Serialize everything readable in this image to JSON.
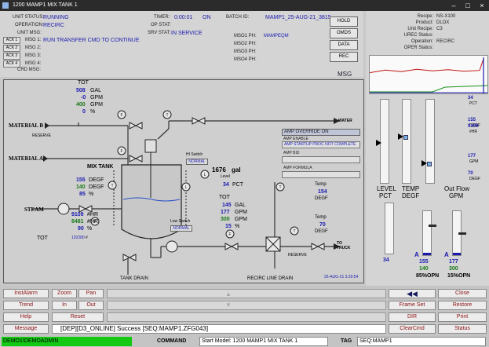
{
  "window": {
    "title": "1200 MAMP1 MIX TANK 1"
  },
  "header": {
    "unit_status_label": "UNIT STATUS:",
    "unit_status": "RUNNING",
    "operation_label": "OPERATION:",
    "operation": "RECIRC",
    "unit_msg_label": "UNIT MSG:",
    "timer_label": "TIMER:",
    "timer": "0:00:01",
    "timer_state": "ON",
    "op_stat_label": "OP STAT:",
    "srv_stat_label": "SRV STAT:",
    "srv_stat": "IN SERVICE",
    "batch_id_label": "BATCH ID:",
    "batch_id": "MAMP1_25-AUG-21_3815",
    "msg_rows": [
      {
        "ack": "ACK 1",
        "label": "MSG 1:",
        "text": "RUN TRANSFER CMD TO CONTINUE"
      },
      {
        "ack": "ACK 2",
        "label": "MSG 2:",
        "text": ""
      },
      {
        "ack": "ACK 3",
        "label": "MSG 3:",
        "text": ""
      },
      {
        "ack": "ACK 4",
        "label": "MSG 4:",
        "text": ""
      }
    ],
    "crd_msg_label": "CRD MSG:",
    "mso_rows": [
      {
        "label": "MSO1 PH:",
        "text": "MAMPEQM"
      },
      {
        "label": "MSO2 PH:",
        "text": ""
      },
      {
        "label": "MSO3 PH:",
        "text": ""
      },
      {
        "label": "MSO4 PH:",
        "text": ""
      }
    ],
    "buttons": [
      "HOLD",
      "OMDS",
      "DATA",
      "REC"
    ],
    "msg_label": "MSG"
  },
  "recipe": {
    "rows": [
      {
        "label": "Recipe:",
        "value": "NS-X100"
      },
      {
        "label": "Product:",
        "value": "DLOX"
      },
      {
        "label": "Unit Recipe:",
        "value": "C3"
      },
      {
        "label": "UREC Status:",
        "value": ""
      },
      {
        "label": "Operation:",
        "value": "RECIRC"
      },
      {
        "label": "OPER Status:",
        "value": ""
      }
    ]
  },
  "process": {
    "tot_label": "TOT",
    "feed_gal": "508",
    "feed_gal_unit": "GAL",
    "feed_gpm": "-0",
    "feed_gpm_unit": "GPM",
    "feed_sp": "400",
    "feed_sp_unit": "GPM",
    "feed_pct": "0",
    "feed_pct_unit": "%",
    "material_b": "MATERIAL B",
    "reserve": "RESERVE",
    "material_a": "MATERIAL A",
    "water": "WATER",
    "mix_tank": "MIX TANK",
    "temp_pv": "155",
    "temp_sp": "140",
    "temp_out": "85",
    "degf": "DEGF",
    "pct": "%",
    "steam": "STEAM",
    "steam_pv": "9109",
    "steam_sp": "8481",
    "steam_out": "90",
    "steam_unit": "#HR",
    "tot2_label": "TOT",
    "tot2_value": "120280",
    "tot2_unit": "#",
    "level_value": "1676",
    "level_unit": "gal",
    "level_label": "Level",
    "level_pct": "34",
    "level_pct_unit": "PCT",
    "hi_switch": "HI Switch",
    "hi_state": "NORMAL",
    "low_switch": "Low Switch",
    "low_state": "NORMAL",
    "out_tot": "TOT",
    "out_gal": "145",
    "out_gal_unit": "GAL",
    "out_gpm": "177",
    "out_gpm_unit": "GPM",
    "out_sp": "300",
    "out_sp_unit": "GPM",
    "out_pct": "15",
    "out_pct_unit": "%",
    "temp_label": "Temp",
    "temp1": "154",
    "temp1_unit": "DEGF",
    "temp2_label": "Temp",
    "temp2": "70",
    "temp2_unit": "DEGF",
    "to_truck": "TO TRUCK",
    "reserve2": "RESERVE",
    "tank_drain": "TANK DRAIN",
    "recirc_drain": "RECIRC LINE DRAIN",
    "date": "25-AUG-21 3:20:54",
    "amp_override": "AMP OVERRIDE ON",
    "amp_enable": "AMP ENABLE",
    "amp_status": "AMP STARTUP PROC NOT COMPLETE",
    "amp_bid": "AMP BID",
    "amp_formula": "AMP FORMULA"
  },
  "right_panel": {
    "trend_hist": [
      0.55,
      0.62,
      0.58,
      0.64,
      0.6,
      0.63,
      0.59,
      0.61
    ],
    "scale": [
      {
        "v": "34",
        "u": "PCT"
      },
      {
        "v": "155",
        "u": "DEGF"
      },
      {
        "v": "9109",
        "u": "#HR"
      },
      {
        "v": "177",
        "u": "GPM"
      },
      {
        "v": "70",
        "u": "DEGF"
      }
    ],
    "levels": [
      "LEVEL",
      "TEMP",
      "Out Flow"
    ],
    "level_units": [
      "PCT",
      "DEGF",
      "GPM"
    ],
    "lvl_val": "34",
    "temp_val1": "155",
    "temp_val2": "140",
    "temp_val3": "85%OPN",
    "flow_val1": "177",
    "flow_val2": "300",
    "flow_val3": "15%OPN",
    "a_marker": "A",
    "colors": {
      "red": "#c01414",
      "green": "#159015",
      "blue": "#1a1ab0"
    }
  },
  "buttons": {
    "row1": [
      "InstAlarm",
      "Zoom",
      "Pan"
    ],
    "row2": [
      "Trend",
      "In",
      "Out"
    ],
    "row3": [
      "Help",
      "Reset"
    ],
    "message_label": "Message",
    "message": "[DEP][D3_ONLINE] Success [SEQ:MAMP1.ZFG043]",
    "right": [
      "Close",
      "Frame Set",
      "Restore",
      "DIR",
      "Print",
      "ClearCmd",
      "Status"
    ]
  },
  "status_bar": {
    "user": "DEMO1\\DEMOADMIN",
    "command_label": "COMMAND",
    "command": "Start Model: 1200 MAMP1 MIX TANK 1",
    "tag_label": "TAG",
    "tag": "SEQ:MAMP1"
  }
}
